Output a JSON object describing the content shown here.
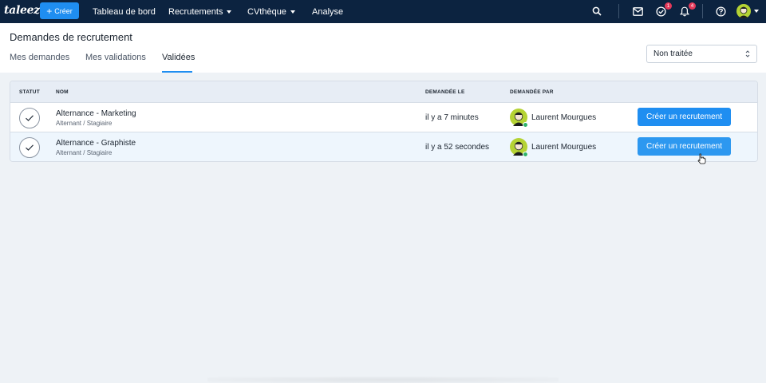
{
  "topbar": {
    "logo": "taleez",
    "create_label": "Créer",
    "nav": [
      {
        "label": "Tableau de bord",
        "dropdown": false
      },
      {
        "label": "Recrutements",
        "dropdown": true
      },
      {
        "label": "CVthèque",
        "dropdown": true
      },
      {
        "label": "Analyse",
        "dropdown": false
      }
    ],
    "icons": [
      "search-icon",
      "mail-icon",
      "task-check-icon",
      "bell-icon",
      "help-icon"
    ],
    "tasks_badge": "1",
    "notifications_badge": "4"
  },
  "page": {
    "title": "Demandes de recrutement",
    "tabs": [
      {
        "label": "Mes demandes",
        "active": false
      },
      {
        "label": "Mes validations",
        "active": false
      },
      {
        "label": "Validées",
        "active": true
      }
    ],
    "status_filter": "Non traitée"
  },
  "table": {
    "headers": {
      "statut": "STATUT",
      "nom": "NOM",
      "demandee_le": "DEMANDÉE LE",
      "demandee_par": "DEMANDÉE PAR"
    },
    "rows": [
      {
        "name": "Alternance - Marketing",
        "type": "Alternant / Stagiaire",
        "requested": "il y a 7 minutes",
        "requester": "Laurent Mourgues",
        "action": "Créer un recrutement"
      },
      {
        "name": "Alternance - Graphiste",
        "type": "Alternant / Stagiaire",
        "requested": "il y a 52 secondes",
        "requester": "Laurent Mourgues",
        "action": "Créer un recrutement"
      }
    ]
  },
  "colors": {
    "topbar": "#0c2340",
    "accent": "#1f8ef1",
    "badge": "#e5395a",
    "online": "#2fb36a",
    "avatar": "#b5d334"
  }
}
